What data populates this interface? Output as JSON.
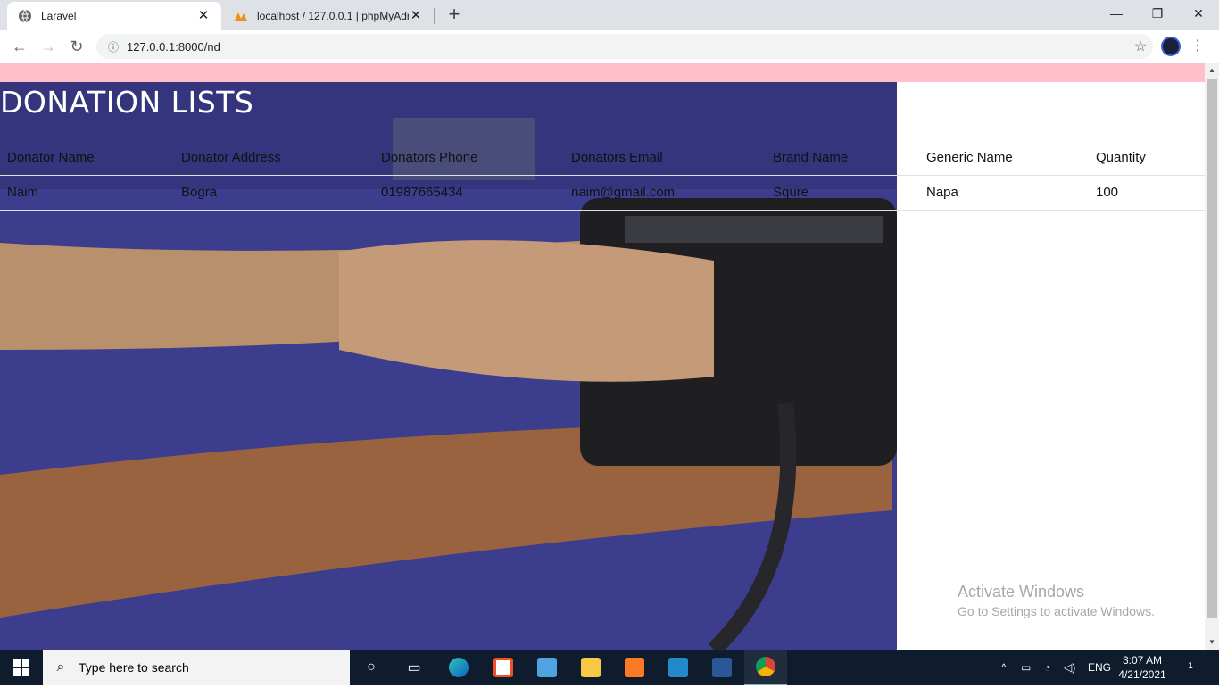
{
  "browser": {
    "tabs": [
      {
        "title": "Laravel",
        "active": true
      },
      {
        "title": "localhost / 127.0.0.1 | phpMyAdm",
        "active": false
      }
    ],
    "url": "127.0.0.1:8000/nd",
    "new_tab_symbol": "+",
    "close_symbol": "✕"
  },
  "window_controls": {
    "minimize": "—",
    "restore": "❐",
    "close": "✕"
  },
  "nav": {
    "back": "←",
    "forward": "→",
    "reload": "↻",
    "info": "ⓘ",
    "star": "☆",
    "menu": "⋮"
  },
  "page": {
    "title": "DONATION LISTS",
    "table": {
      "headers": [
        "Donator Name",
        "Donator Address",
        "Donators Phone",
        "Donators Email",
        "Brand Name",
        "Generic Name",
        "Quantity"
      ],
      "rows": [
        [
          "Naim",
          "Bogra",
          "01987665434",
          "naim@gmail.com",
          "Squre",
          "Napa",
          "100"
        ]
      ]
    },
    "colors": {
      "top_bar": "#ffc0cb"
    }
  },
  "watermark": {
    "line1": "Activate Windows",
    "line2": "Go to Settings to activate Windows."
  },
  "taskbar": {
    "search_placeholder": "Type here to search",
    "apps": [
      "task-view-icon",
      "edge-icon",
      "store-icon",
      "mail-icon",
      "file-explorer-icon",
      "xampp-icon",
      "vscode-icon",
      "word-icon",
      "chrome-icon"
    ],
    "language": "ENG",
    "time": "3:07 AM",
    "date": "4/21/2021",
    "notification_count": "1"
  }
}
